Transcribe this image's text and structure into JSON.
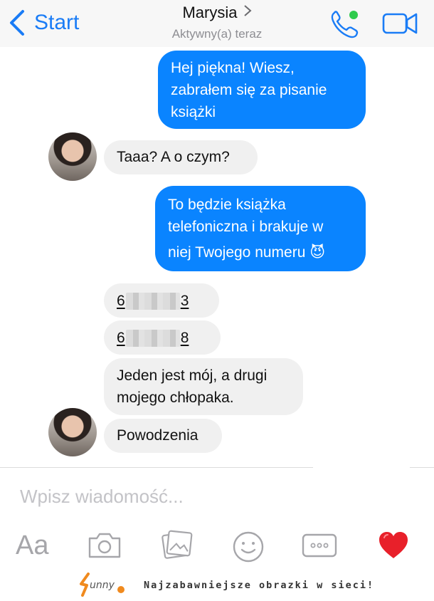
{
  "header": {
    "back_label": "Start",
    "contact_name": "Marysia",
    "contact_status": "Aktywny(a) teraz",
    "call_icon": "phone-icon",
    "video_icon": "video-camera-icon",
    "accent_color": "#1a7cf6",
    "online_color": "#2fcb4c"
  },
  "messages": [
    {
      "side": "out",
      "lines": [
        "Hej piękna! Wiesz,",
        "zabrałem się za pisanie",
        "książki"
      ]
    },
    {
      "side": "in",
      "text": "Taaa? A o czym?"
    },
    {
      "side": "out",
      "lines": [
        "To będzie książka",
        "telefoniczna i brakuje w",
        "niej Twojego numeru"
      ],
      "emoji": "😈"
    },
    {
      "side": "in",
      "phone_start": "6",
      "phone_end": "3"
    },
    {
      "side": "in",
      "phone_start": "6",
      "phone_end": "8"
    },
    {
      "side": "in",
      "lines": [
        "Jeden jest mój, a drugi",
        "mojego chłopaka."
      ]
    },
    {
      "side": "in",
      "text": "Powodzenia"
    }
  ],
  "composer": {
    "placeholder": "Wpisz wiadomość...",
    "toolbar": [
      "Aa",
      "camera-icon",
      "gallery-icon",
      "emoji-icon",
      "more-icon",
      "heart-icon"
    ]
  },
  "watermark": {
    "slogan": "Najzabawniejsze obrazki w sieci!"
  },
  "colors": {
    "outgoing_bubble": "#0a84ff",
    "incoming_bubble": "#f0f0f0",
    "heart": "#e8202a"
  }
}
